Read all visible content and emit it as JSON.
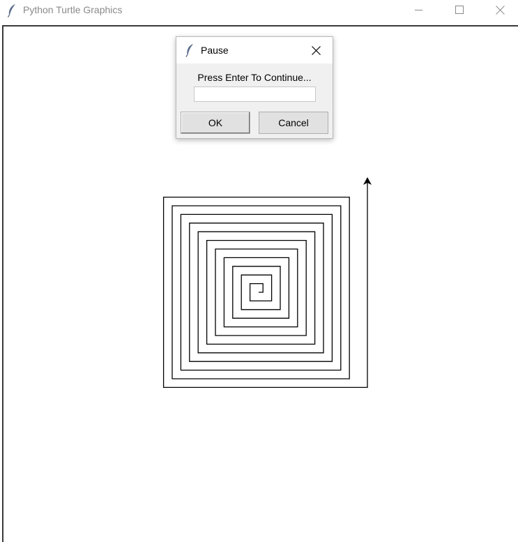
{
  "window": {
    "title": "Python Turtle Graphics",
    "icon": "feather-icon",
    "controls": [
      "minimize-icon",
      "maximize-icon",
      "close-icon"
    ]
  },
  "canvas": {
    "drawing": "square spiral",
    "stroke_color": "#000000",
    "background_color": "#ffffff",
    "turtle_heading": "up"
  },
  "dialog": {
    "title": "Pause",
    "icon": "feather-icon",
    "prompt": "Press Enter To Continue...",
    "input_value": "",
    "input_placeholder": "",
    "ok_label": "OK",
    "cancel_label": "Cancel"
  },
  "colors": {
    "titlebar_text": "#8a8a8a",
    "dialog_background": "#f0f0f0",
    "button_face": "#e1e1e1"
  }
}
